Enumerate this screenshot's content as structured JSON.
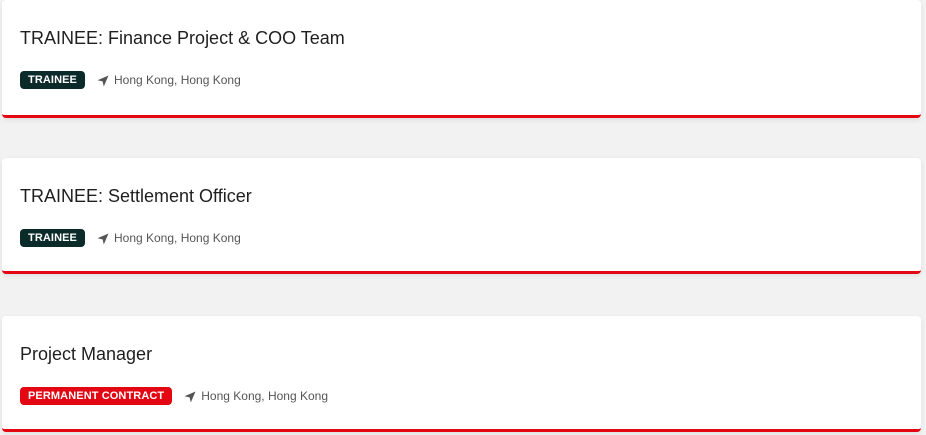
{
  "colors": {
    "accent_red": "#e30613",
    "trainee_badge": "#0b2a2a",
    "permanent_badge": "#e30613",
    "icon_gray": "#555555"
  },
  "jobs": [
    {
      "title": "TRAINEE: Finance Project & COO Team",
      "badge": "TRAINEE",
      "location": "Hong Kong, Hong Kong",
      "location_icon": "location-arrow-icon"
    },
    {
      "title": "TRAINEE: Settlement Officer",
      "badge": "TRAINEE",
      "location": "Hong Kong, Hong Kong",
      "location_icon": "location-arrow-icon"
    },
    {
      "title": "Project Manager",
      "badge": "PERMANENT CONTRACT",
      "location": "Hong Kong, Hong Kong",
      "location_icon": "location-arrow-icon"
    }
  ]
}
